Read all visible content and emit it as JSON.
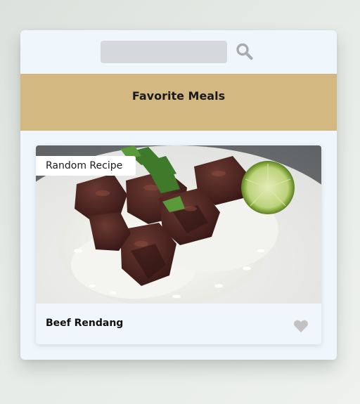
{
  "search": {
    "value": "",
    "placeholder": ""
  },
  "favorites": {
    "title": "Favorite Meals"
  },
  "meal": {
    "tag": "Random Recipe",
    "name": "Beef Rendang",
    "image_alt": "Beef Rendang with rice and lime"
  },
  "icons": {
    "search": "search-icon",
    "favorite": "heart-icon"
  },
  "colors": {
    "favorites_banner": "#d4b882",
    "card_background": "#eff7fd",
    "search_field": "#d5d9dd",
    "icon_gray": "#a9acae",
    "heart_gray": "#c2c2c2"
  }
}
